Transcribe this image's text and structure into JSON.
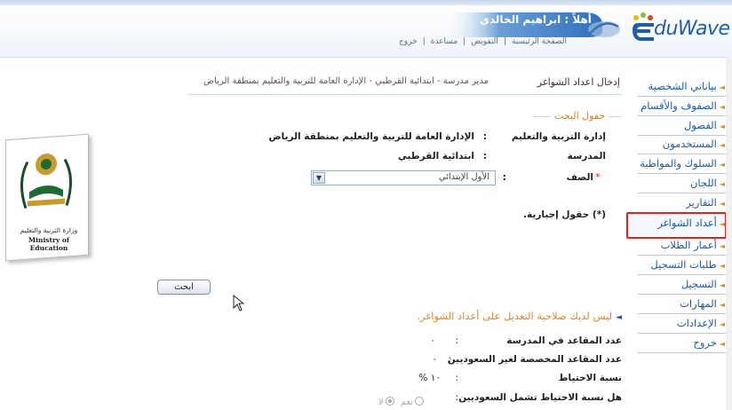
{
  "header": {
    "welcome": "أهلاً : ابراهيم الخالدي",
    "links": [
      "الصفحة الرئيسية",
      "التفويض",
      "مساعدة",
      "خروج"
    ],
    "link_separator": "|",
    "logo": {
      "prefix": "E",
      "name": "duWave"
    }
  },
  "sidebar": {
    "items": [
      {
        "label": "بياناتي الشخصية"
      },
      {
        "label": "الصفوف والأقسام"
      },
      {
        "label": "الفصول"
      },
      {
        "label": "المستخدمون"
      },
      {
        "label": "السلوك والمواظبة"
      },
      {
        "label": "اللجان"
      },
      {
        "label": "التقارير"
      },
      {
        "label": "أعداد الشواغر"
      },
      {
        "label": "أعمار الطلاب"
      },
      {
        "label": "طلبات التسجيل"
      },
      {
        "label": "التسجيل"
      },
      {
        "label": "المهارات"
      },
      {
        "label": "الإعدادات"
      },
      {
        "label": "خروج"
      }
    ],
    "active_index": 7,
    "colors": {
      "link": "#1b58b0",
      "bullet": "#e38b1a",
      "highlight": "#e02222"
    }
  },
  "main": {
    "section_title": "إدخال اعداد الشواغر",
    "path": "مدير مدرسة - ابتدائية القرطبي - الإدارة العامة للتربية والتعليم بمنطقة الرياض",
    "search_fields": {
      "legend": "حقول البحث",
      "rows": [
        {
          "label": "إدارة التربية والتعليم",
          "sep": ":",
          "value": "الإدارة العامة للتربية والتعليم بمنطقة الرياض"
        },
        {
          "label": "المدرسة",
          "sep": ":",
          "value": "ابتدائية القرطبي"
        }
      ],
      "grade": {
        "label": "الصف",
        "required_mark": "*",
        "sep": ":",
        "selected": "الأول الإبتدائي"
      },
      "required_note": "(*) حقول إجبارية."
    },
    "search_button": "ابحث",
    "notice": "ليس لديك صلاحية التعديل على أعداد الشواغر.",
    "info": [
      {
        "label": "عدد المقاعد في المدرسة",
        "sep": ":",
        "value": "٠"
      },
      {
        "label": "عدد المقاعد المخصصة لغير السعوديين",
        "sep": ":",
        "value": "٠"
      },
      {
        "label": "نسبة الاحتياط",
        "sep": ":",
        "value": "١٠ %"
      },
      {
        "label": "هل نسبة الاحتياط تشمل السعوديين",
        "sep": ":",
        "options": [
          "نعم",
          "لا"
        ],
        "selected": "لا"
      }
    ],
    "ministry": {
      "arabic": "وزارة التربية والتعليم",
      "english": "Ministry of Education"
    }
  }
}
